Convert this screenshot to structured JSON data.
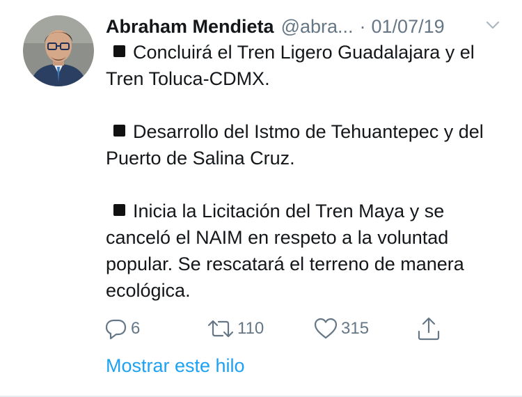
{
  "tweet": {
    "author_name": "Abraham Mendieta",
    "handle": "@abra...",
    "separator": "·",
    "date": "01/07/19",
    "paragraphs": [
      "Concluirá el Tren Ligero Guadalajara y el Tren Toluca-CDMX.",
      "Desarrollo del Istmo de Tehuantepec y del Puerto de Salina Cruz.",
      "Inicia la Licitación del Tren Maya y se canceló el NAIM en respeto a la voluntad popular. Se rescatará el terreno de manera ecológica."
    ],
    "actions": {
      "reply_count": "6",
      "retweet_count": "110",
      "like_count": "315"
    },
    "show_thread_label": "Mostrar este hilo"
  },
  "icons": {
    "reply": "reply-icon",
    "retweet": "retweet-icon",
    "like": "heart-icon",
    "share": "share-icon",
    "caret": "chevron-down-icon",
    "bullet": "black-square-icon"
  },
  "colors": {
    "text": "#14171a",
    "secondary": "#657786",
    "link": "#1da1f2",
    "divider": "#e6ecf0"
  }
}
